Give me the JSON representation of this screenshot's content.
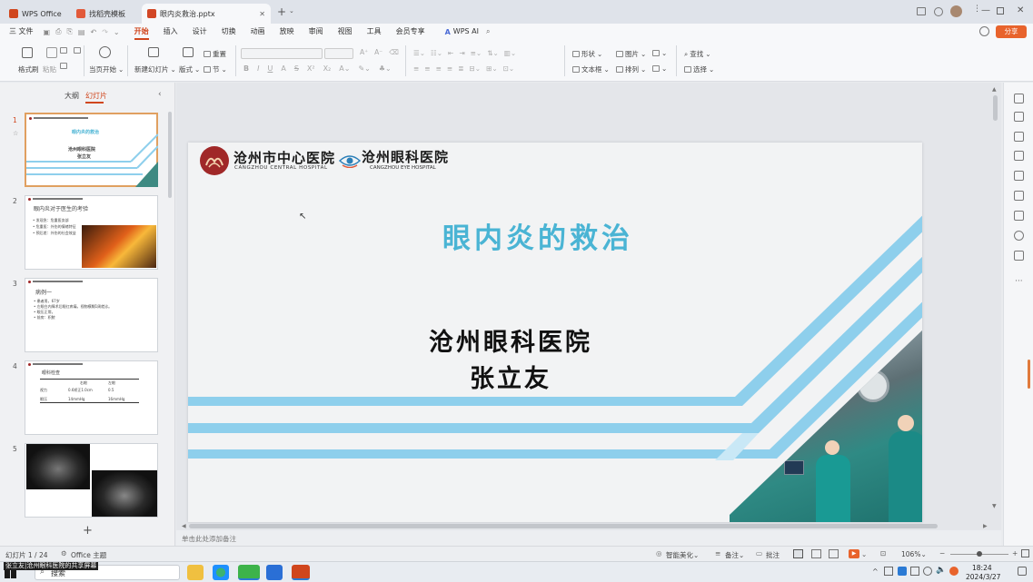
{
  "titlebar": {
    "tabs": [
      {
        "label": "WPS Office",
        "active": false
      },
      {
        "label": "找稻壳模板",
        "active": false
      },
      {
        "label": "眼内炎救治.pptx",
        "active": true
      }
    ],
    "new_tab": "+",
    "accent": "#d0461d"
  },
  "menubar": {
    "file": "三 文件",
    "items": [
      "开始",
      "插入",
      "设计",
      "切换",
      "动画",
      "放映",
      "审阅",
      "视图",
      "工具",
      "会员专享"
    ],
    "active": "开始",
    "wps_ai": "WPS AI",
    "share": "分享"
  },
  "ribbon": {
    "format_painter": "格式刷",
    "paste": "粘贴",
    "play_from_current": "当页开始",
    "new_slide": "新建幻灯片",
    "layout": "版式",
    "section": "节",
    "reset": "重置",
    "shape": "形状",
    "picture": "图片",
    "textbox": "文本框",
    "arrange": "排列",
    "find": "查找",
    "select": "选择"
  },
  "leftpanel": {
    "tab_outline": "大纲",
    "tab_slides": "幻灯片",
    "slides": [
      {
        "num": "1",
        "title": "眼内炎的救治",
        "line1": "沧州眼科医院",
        "line2": "张立友"
      },
      {
        "num": "2",
        "title": "眼内炎对于医生的考验",
        "bullets": [
          "• 发现急：危重医务部",
          "• 危重医：外伤的情绪特征",
          "• 预后差：外伤的社会效益"
        ]
      },
      {
        "num": "3",
        "title": "病例一",
        "bullets": [
          "• 患者男，67岁",
          "• 左眼白内障术后眼红疼痛，视物模糊1周就诊。",
          "• 眼压正常。",
          "• 前房：积脓"
        ]
      },
      {
        "num": "4",
        "title": "眼科检查",
        "table": [
          [
            "",
            "右眼",
            "左眼"
          ],
          [
            "视力",
            "0.6矫正1.0cm",
            "0.5"
          ],
          [
            "眼压",
            "14mmHg",
            "16mmHg"
          ]
        ]
      },
      {
        "num": "5"
      }
    ],
    "add": "+"
  },
  "slide": {
    "hospital1_cn": "沧州市中心医院",
    "hospital1_en": "CANGZHOU CENTRAL HOSPITAL",
    "hospital2_cn": "沧州眼科医院",
    "hospital2_en": "CANGZHOU EYE HOSPITAL",
    "title": "眼内炎的救治",
    "presenter_org": "沧州眼科医院",
    "presenter_name": "张立友",
    "title_color": "#4ab4d4",
    "stripe_color": "#8ecfec",
    "logo_color": "#a02828"
  },
  "notes": {
    "placeholder": "单击此处添加备注"
  },
  "statusbar": {
    "slide_count": "幻灯片 1 / 24",
    "theme": "Office 主题",
    "smart": "智能美化",
    "remarks": "备注",
    "comments": "批注",
    "zoom": "106%"
  },
  "taskbar": {
    "search": "搜索",
    "time": "18:24",
    "date": "2024/3/27",
    "sharing": "张立友|沧州眼科医院的共享屏幕"
  }
}
